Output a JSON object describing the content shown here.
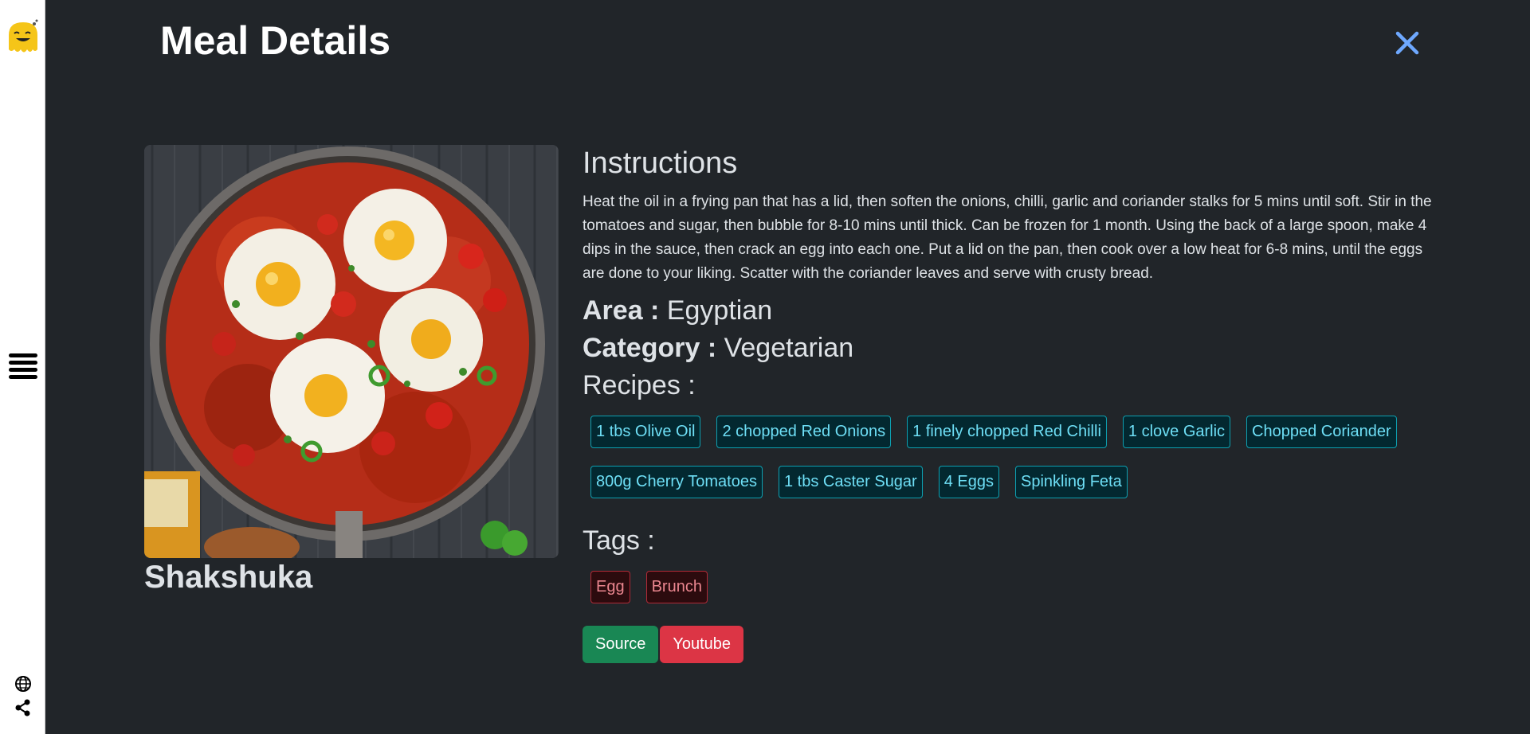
{
  "header": {
    "title": "Meal Details"
  },
  "meal": {
    "name": "Shakshuka",
    "instructions_title": "Instructions",
    "instructions": "Heat the oil in a frying pan that has a lid, then soften the onions, chilli, garlic and coriander stalks for 5 mins until soft. Stir in the tomatoes and sugar, then bubble for 8-10 mins until thick. Can be frozen for 1 month. Using the back of a large spoon, make 4 dips in the sauce, then crack an egg into each one. Put a lid on the pan, then cook over a low heat for 6-8 mins, until the eggs are done to your liking. Scatter with the coriander leaves and serve with crusty bread.",
    "area_label": "Area :",
    "area": "Egyptian",
    "category_label": "Category :",
    "category": "Vegetarian",
    "recipes_label": "Recipes :",
    "ingredients": [
      "1 tbs Olive Oil",
      "2 chopped Red Onions",
      "1 finely chopped Red Chilli",
      "1 clove Garlic",
      "Chopped Coriander",
      "800g Cherry Tomatoes",
      "1 tbs Caster Sugar",
      "4 Eggs",
      "Spinkling Feta"
    ],
    "tags_label": "Tags :",
    "tags": [
      "Egg",
      "Brunch"
    ],
    "source_label": "Source",
    "youtube_label": "Youtube"
  },
  "sidebar": {
    "icons": [
      "logo-icon",
      "menu-icon",
      "globe-icon",
      "share-icon"
    ]
  },
  "colors": {
    "background": "#212529",
    "ingredient_border": "#0d9fb0",
    "tag_border": "#b02a37",
    "source_button": "#198754",
    "youtube_button": "#dc3545",
    "close_icon": "#6ea8fe"
  }
}
